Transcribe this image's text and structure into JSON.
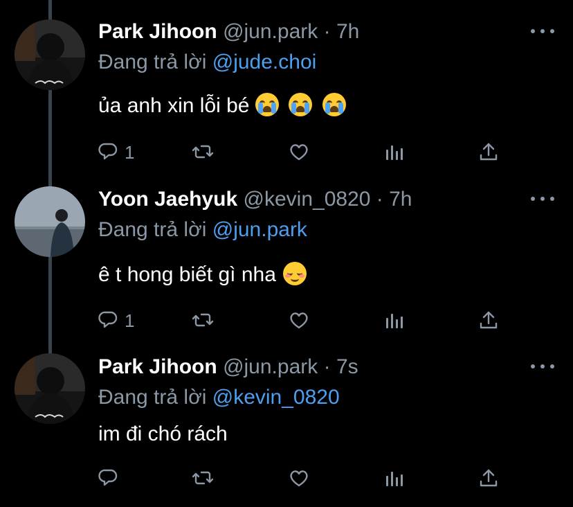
{
  "tweets": [
    {
      "name": "Park Jihoon",
      "handle": "@jun.park",
      "separator": "·",
      "time": "7h",
      "reply_prefix": "Đang trả lời",
      "reply_to": "@jude.choi",
      "text": "ủa anh xin lỗi bé",
      "emojis": [
        "loudly-crying-face",
        "loudly-crying-face",
        "loudly-crying-face"
      ],
      "reply_count": "1"
    },
    {
      "name": "Yoon Jaehyuk",
      "handle": "@kevin_0820",
      "separator": "·",
      "time": "7h",
      "reply_prefix": "Đang trả lời",
      "reply_to": "@jun.park",
      "text": "ê t hong biết gì nha",
      "emojis": [
        "smiling-face"
      ],
      "reply_count": "1"
    },
    {
      "name": "Park Jihoon",
      "handle": "@jun.park",
      "separator": "·",
      "time": "7s",
      "reply_prefix": "Đang trả lời",
      "reply_to": "@kevin_0820",
      "text": "im đi chó rách",
      "emojis": [],
      "reply_count": ""
    }
  ],
  "icons": {
    "more": "more-horizontal-icon",
    "reply": "reply-icon",
    "retweet": "retweet-icon",
    "like": "heart-icon",
    "analytics": "analytics-icon",
    "share": "share-icon"
  },
  "colors": {
    "background": "#000000",
    "text": "#ffffff",
    "secondary": "#8b98a5",
    "link": "#4d9ff0",
    "thread_line": "#38444d"
  }
}
